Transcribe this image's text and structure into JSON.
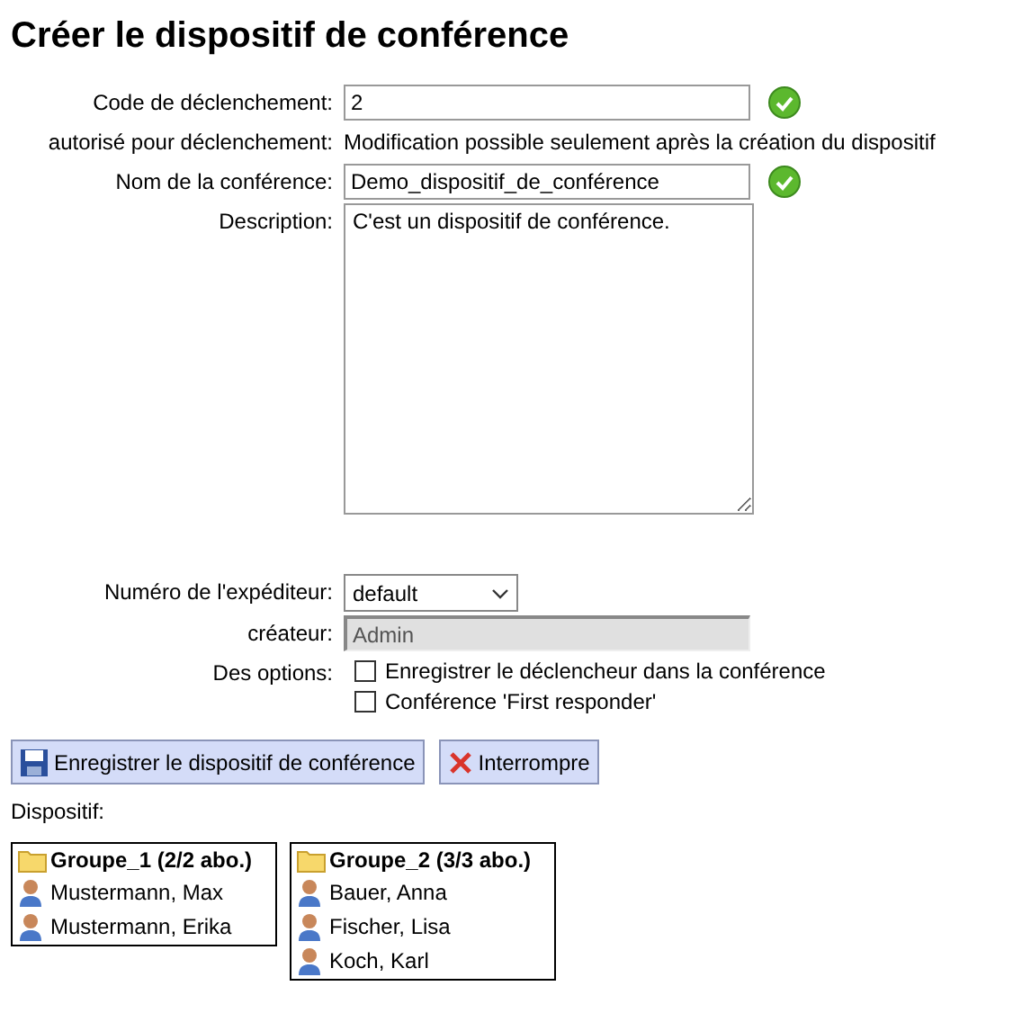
{
  "title": "Créer le dispositif de conférence",
  "form": {
    "trigger_code": {
      "label": "Code de déclenchement:",
      "value": "2",
      "valid": true
    },
    "authorized": {
      "label": "autorisé pour déclenchement:",
      "note": "Modification possible seulement après la création du dispositif"
    },
    "name": {
      "label": "Nom de la conférence:",
      "value": "Demo_dispositif_de_conférence",
      "valid": true
    },
    "description": {
      "label": "Description:",
      "value": "C'est un dispositif de conférence."
    },
    "sender": {
      "label": "Numéro de l'expéditeur:",
      "value": "default"
    },
    "creator": {
      "label": "créateur:",
      "value": "Admin",
      "disabled": true
    },
    "options": {
      "label": "Des options:",
      "items": [
        {
          "label": "Enregistrer le déclencheur dans la conférence",
          "checked": false
        },
        {
          "label": "Conférence 'First responder'",
          "checked": false
        }
      ]
    }
  },
  "buttons": [
    {
      "kind": "save",
      "label": "Enregistrer le dispositif de conférence"
    },
    {
      "kind": "cancel",
      "label": "Interrompre"
    }
  ],
  "devices_label": "Dispositif:",
  "groups": [
    {
      "name": "Groupe_1 (2/2 abo.)",
      "members": [
        "Mustermann, Max",
        "Mustermann, Erika"
      ]
    },
    {
      "name": "Groupe_2 (3/3 abo.)",
      "members": [
        "Bauer, Anna",
        "Fischer, Lisa",
        "Koch, Karl"
      ]
    }
  ]
}
